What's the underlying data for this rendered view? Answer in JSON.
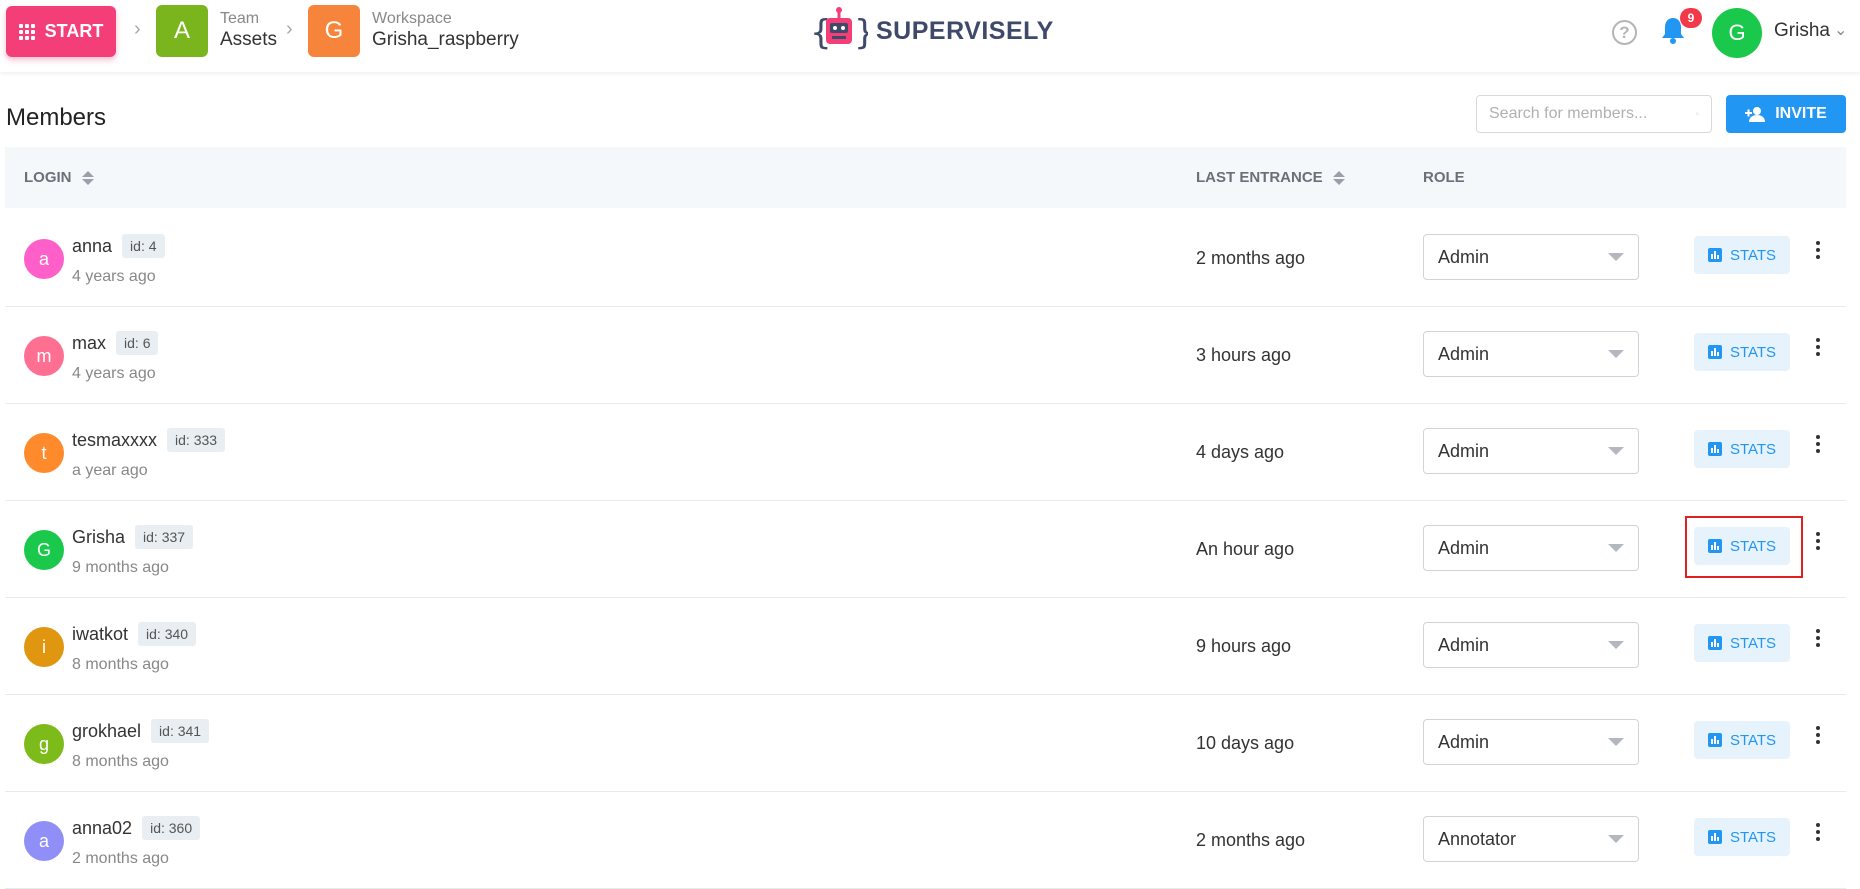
{
  "header": {
    "start_label": "START",
    "team": {
      "letter": "A",
      "label": "Team",
      "value": "Assets",
      "color": "#7ab51d"
    },
    "workspace": {
      "letter": "G",
      "label": "Workspace",
      "value": "Grisha_raspberry",
      "color": "#f6843a"
    },
    "logo_text": "SUPERVISELY",
    "notifications_count": "9",
    "user": {
      "initial": "G",
      "name": "Grisha"
    }
  },
  "members": {
    "title": "Members",
    "search_placeholder": "Search for members...",
    "invite_label": "INVITE",
    "columns": {
      "login": "LOGIN",
      "last_entrance": "LAST ENTRANCE",
      "role": "ROLE"
    },
    "stats_label": "STATS",
    "rows": [
      {
        "initial": "a",
        "name": "anna",
        "id": "id: 4",
        "joined": "4 years ago",
        "last": "2 months ago",
        "role": "Admin",
        "color": "#ff5fc9"
      },
      {
        "initial": "m",
        "name": "max",
        "id": "id: 6",
        "joined": "4 years ago",
        "last": "3 hours ago",
        "role": "Admin",
        "color": "#ff6f91"
      },
      {
        "initial": "t",
        "name": "tesmaxxxx",
        "id": "id: 333",
        "joined": "a year ago",
        "last": "4 days ago",
        "role": "Admin",
        "color": "#ff8a2b"
      },
      {
        "initial": "G",
        "name": "Grisha",
        "id": "id: 337",
        "joined": "9 months ago",
        "last": "An hour ago",
        "role": "Admin",
        "color": "#1ac94b"
      },
      {
        "initial": "i",
        "name": "iwatkot",
        "id": "id: 340",
        "joined": "8 months ago",
        "last": "9 hours ago",
        "role": "Admin",
        "color": "#e0960e"
      },
      {
        "initial": "g",
        "name": "grokhael",
        "id": "id: 341",
        "joined": "8 months ago",
        "last": "10 days ago",
        "role": "Admin",
        "color": "#7cbb1a"
      },
      {
        "initial": "a",
        "name": "anna02",
        "id": "id: 360",
        "joined": "2 months ago",
        "last": "2 months ago",
        "role": "Annotator",
        "color": "#8f8ff7"
      }
    ]
  },
  "colors": {
    "accent": "#2196f3",
    "start": "#f43e77",
    "highlight": "#e02121"
  }
}
